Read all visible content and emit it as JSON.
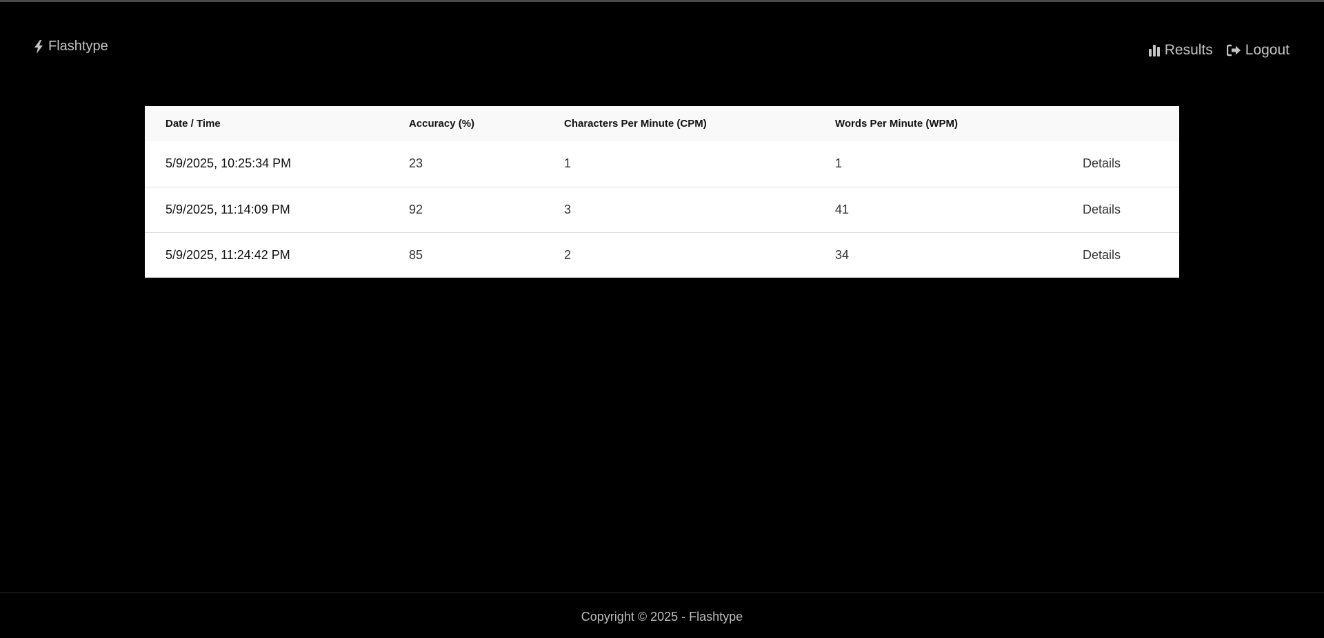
{
  "navbar": {
    "brand": "Flashtype",
    "brand_icon": "bolt-icon",
    "links": [
      {
        "label": "Results",
        "icon": "bar-chart-icon"
      },
      {
        "label": "Logout",
        "icon": "sign-out-icon"
      }
    ]
  },
  "results_table": {
    "headers": [
      "Date / Time",
      "Accuracy (%)",
      "Characters Per Minute (CPM)",
      "Words Per Minute (WPM)",
      ""
    ],
    "rows": [
      {
        "datetime": "5/9/2025, 10:25:34 PM",
        "accuracy": "23",
        "cpm": "1",
        "wpm": "1",
        "action": "Details"
      },
      {
        "datetime": "5/9/2025, 11:14:09 PM",
        "accuracy": "92",
        "cpm": "3",
        "wpm": "41",
        "action": "Details"
      },
      {
        "datetime": "5/9/2025, 11:24:42 PM",
        "accuracy": "85",
        "cpm": "2",
        "wpm": "34",
        "action": "Details"
      }
    ]
  },
  "footer": {
    "copyright": "Copyright © 2025 - Flashtype"
  },
  "colors": {
    "background": "#000000",
    "nav_text": "#c4c4c4",
    "table_bg": "#ffffff",
    "header_bg": "#f9f9f9"
  }
}
